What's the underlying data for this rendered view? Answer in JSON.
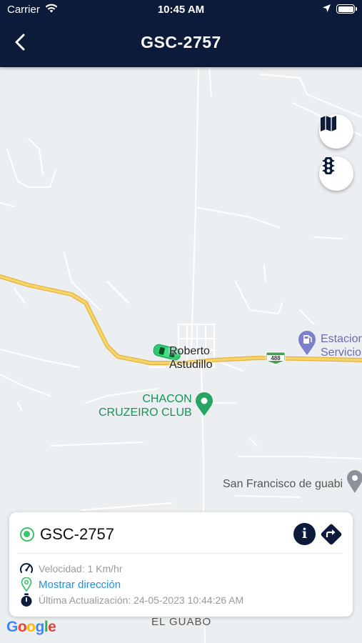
{
  "status_bar": {
    "carrier": "Carrier",
    "time": "10:45 AM"
  },
  "nav": {
    "title": "GSC-2757",
    "back_icon": "chevron-left-icon"
  },
  "map": {
    "labels": {
      "town": "Roberto\nAstudillo",
      "club": "CHACON\nCRUZEIRO CLUB",
      "estacion": "Estacion\nServicio",
      "san_francisco": "San Francisco de guabi",
      "el_guabo": "EL GUABO",
      "route": "488"
    },
    "attribution": [
      "G",
      "o",
      "o",
      "g",
      "l",
      "e"
    ],
    "buttons": {
      "map_type_icon": "map-icon",
      "traffic_icon": "traffic-light-icon"
    },
    "colors": {
      "road_main": "#f2c94c",
      "vehicle": "#2ecc71",
      "poi_green": "#17935a",
      "poi_purple": "#7b7fce"
    }
  },
  "vehicle_card": {
    "plate": "GSC-2757",
    "status_color": "#3cc36b",
    "speed": "Velocidad: 1 Km/hr",
    "address_link": "Mostrar dirección",
    "last_update": "Última Actualización: 24-05-2023 10:44:26 AM",
    "info_icon": "info-icon",
    "directions_icon": "directions-icon"
  }
}
